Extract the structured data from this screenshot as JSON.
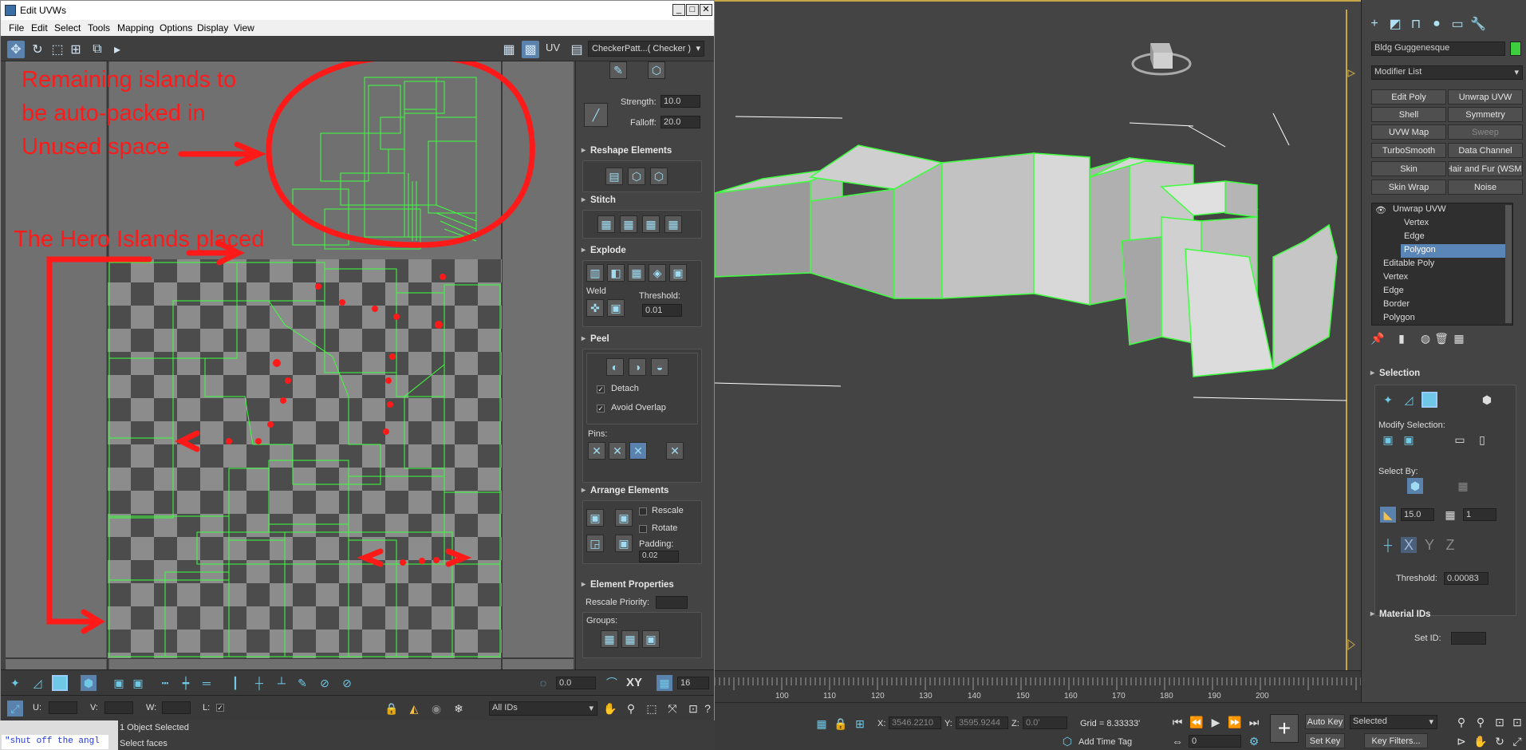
{
  "uvw_window": {
    "title": "Edit UVWs",
    "menu": [
      "File",
      "Edit",
      "Select",
      "Tools",
      "Mapping",
      "Options",
      "Display",
      "View"
    ],
    "uv_label": "UV",
    "checker_dropdown": "CheckerPatt...( Checker )"
  },
  "annotations": {
    "remaining_line1": "Remaining islands to",
    "remaining_line2": "be auto-packed in",
    "remaining_line3": "Unused space",
    "hero": "The Hero Islands placed"
  },
  "panel": {
    "strength_label": "Strength:",
    "strength_value": "10.0",
    "falloff_label": "Falloff:",
    "falloff_value": "20.0",
    "reshape_title": "Reshape Elements",
    "stitch_title": "Stitch",
    "explode_title": "Explode",
    "weld_label": "Weld",
    "threshold_label": "Threshold:",
    "threshold_value": "0.01",
    "peel_title": "Peel",
    "detach_label": "Detach",
    "avoid_overlap_label": "Avoid Overlap",
    "pins_label": "Pins:",
    "arrange_title": "Arrange Elements",
    "rescale_label": "Rescale",
    "rotate_label": "Rotate",
    "padding_label": "Padding:",
    "padding_value": "0.02",
    "element_props_title": "Element Properties",
    "rescale_priority_label": "Rescale Priority:",
    "groups_label": "Groups:"
  },
  "uvw_bottom": {
    "angle_value": "0.0",
    "xy_label": "XY",
    "grid_value": "16",
    "u_label": "U:",
    "v_label": "V:",
    "w_label": "W:",
    "l_label": "L:",
    "ids_dropdown": "All IDs"
  },
  "status": {
    "script_text": "\"shut off the angl",
    "selection": "1 Object Selected",
    "prompt": "Select faces",
    "x_label": "X:",
    "x_value": "3546.2210",
    "y_label": "Y:",
    "y_value": "3595.9244",
    "z_label": "Z:",
    "z_value": "0.0'",
    "grid": "Grid = 8.33333'",
    "add_time_tag": "Add Time Tag",
    "auto_key": "Auto Key",
    "set_key": "Set Key",
    "selected_dd": "Selected",
    "key_filters": "Key Filters...",
    "frame_value": "0"
  },
  "timeline": {
    "ticks": [
      "100",
      "110",
      "120",
      "130",
      "140",
      "150",
      "160",
      "170",
      "180",
      "190",
      "200"
    ]
  },
  "command_panel": {
    "object_name": "Bldg Guggenesque",
    "modifier_list": "Modifier List",
    "modifier_buttons": [
      "Edit Poly",
      "Unwrap UVW",
      "Shell",
      "Symmetry",
      "UVW Map",
      "Sweep",
      "TurboSmooth",
      "Data Channel",
      "Skin",
      "Hair and Fur (WSM)",
      "Skin Wrap",
      "Noise"
    ],
    "stack": [
      {
        "label": "Unwrap UVW",
        "level": 0
      },
      {
        "label": "Vertex",
        "level": 1
      },
      {
        "label": "Edge",
        "level": 1
      },
      {
        "label": "Polygon",
        "level": 1
      },
      {
        "label": "Editable Poly",
        "level": 0
      },
      {
        "label": "Vertex",
        "level": 1
      },
      {
        "label": "Edge",
        "level": 1
      },
      {
        "label": "Border",
        "level": 1
      },
      {
        "label": "Polygon",
        "level": 1
      }
    ],
    "selection_title": "Selection",
    "modify_selection_label": "Modify Selection:",
    "select_by_label": "Select By:",
    "angle_value": "15.0",
    "count_value": "1",
    "threshold_label": "Threshold:",
    "threshold_value": "0.00083",
    "x_axis": "X",
    "y_axis": "Y",
    "z_axis": "Z",
    "material_ids_title": "Material IDs",
    "set_id_label": "Set ID:"
  },
  "colors": {
    "annotation_red": "#ff1a1a",
    "uv_green": "#3dff3d",
    "selection_blue": "#5a85b7",
    "checker_dark": "#4b4b4b",
    "checker_light": "#8a8a8a"
  }
}
